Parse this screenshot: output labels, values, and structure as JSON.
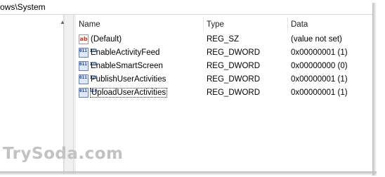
{
  "address_bar": {
    "path": "ows\\System"
  },
  "columns": {
    "name": "Name",
    "type": "Type",
    "data": "Data"
  },
  "rows": [
    {
      "name": "(Default)",
      "type": "REG_SZ",
      "data": "(value not set)",
      "icon": "string-value-icon"
    },
    {
      "name": "EnableActivityFeed",
      "type": "REG_DWORD",
      "data": "0x00000001 (1)",
      "icon": "dword-value-icon"
    },
    {
      "name": "EnableSmartScreen",
      "type": "REG_DWORD",
      "data": "0x00000000 (0)",
      "icon": "dword-value-icon"
    },
    {
      "name": "PublishUserActivities",
      "type": "REG_DWORD",
      "data": "0x00000001 (1)",
      "icon": "dword-value-icon"
    },
    {
      "name": "UploadUserActivities",
      "type": "REG_DWORD",
      "data": "0x00000001 (1)",
      "icon": "dword-value-icon",
      "selected": true
    }
  ],
  "icon_glyphs": {
    "string": "ab",
    "binary": "011 110"
  },
  "watermark": "TrySoda.com",
  "colors": {
    "string_icon": "#c0392b",
    "binary_icon": "#1d3e8a",
    "watermark": "#c2c2c2"
  }
}
